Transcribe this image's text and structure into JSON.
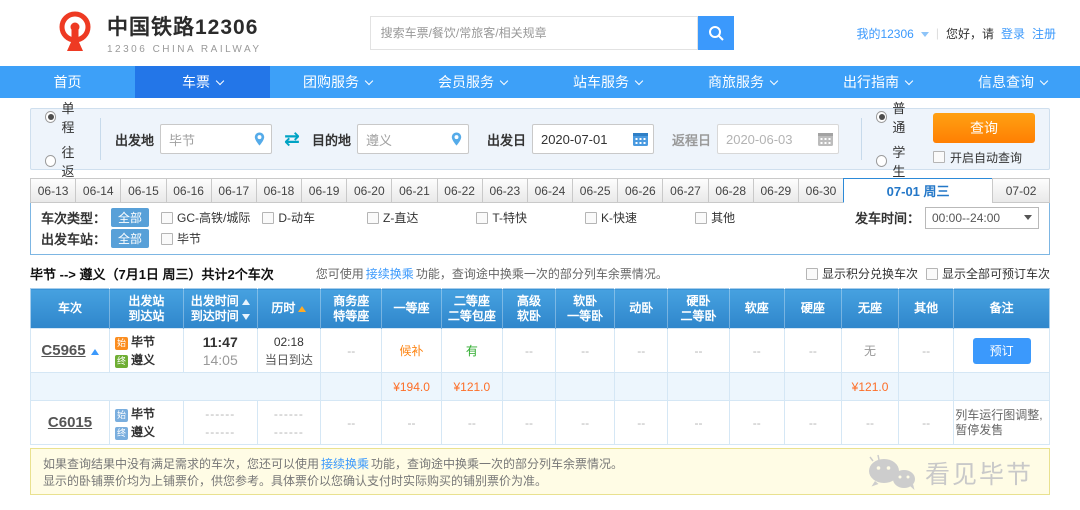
{
  "brand": {
    "title": "中国铁路12306",
    "subtitle": "12306 CHINA RAILWAY"
  },
  "topbar": {
    "search_placeholder": "搜索车票/餐饮/常旅客/相关规章",
    "my12306": "我的12306",
    "divider": "|",
    "greeting": "您好，请",
    "login": "登录",
    "register": "注册"
  },
  "nav": {
    "items": [
      {
        "label": "首页"
      },
      {
        "label": "车票"
      },
      {
        "label": "团购服务"
      },
      {
        "label": "会员服务"
      },
      {
        "label": "站车服务"
      },
      {
        "label": "商旅服务"
      },
      {
        "label": "出行指南"
      },
      {
        "label": "信息查询"
      }
    ]
  },
  "form": {
    "one_way": "单程",
    "round_trip": "往返",
    "from_label": "出发地",
    "from_value": "毕节",
    "to_label": "目的地",
    "to_value": "遵义",
    "depart_label": "出发日",
    "depart_value": "2020-07-01",
    "return_label": "返程日",
    "return_value": "2020-06-03",
    "normal": "普通",
    "student": "学生",
    "query": "查询",
    "auto_query": "开启自动查询"
  },
  "dates": {
    "items": [
      "06-13",
      "06-14",
      "06-15",
      "06-16",
      "06-17",
      "06-18",
      "06-19",
      "06-20",
      "06-21",
      "06-22",
      "06-23",
      "06-24",
      "06-25",
      "06-26",
      "06-27",
      "06-28",
      "06-29",
      "06-30"
    ],
    "selected": "07-01 周三",
    "next": "07-02"
  },
  "filters": {
    "type_label": "车次类型：",
    "all": "全部",
    "types": [
      "GC-高铁/城际",
      "D-动车",
      "Z-直达",
      "T-特快",
      "K-快速",
      "其他"
    ],
    "station_label": "出发车站：",
    "station": "毕节",
    "time_label": "发车时间：",
    "time_value": "00:00--24:00"
  },
  "results": {
    "summary": "毕节 --> 遵义（7月1日 周三）共计2个车次",
    "tip_prefix": "您可使用",
    "tip_link": "接续换乘",
    "tip_suffix": "功能，查询途中换乘一次的部分列车余票情况。",
    "show_points": "显示积分兑换车次",
    "show_all": "显示全部可预订车次"
  },
  "table": {
    "headers": {
      "train": "车次",
      "from": "出发站",
      "to": "到达站",
      "dep": "出发时间",
      "arr": "到达时间",
      "dur": "历时",
      "biz1": "商务座",
      "biz2": "特等座",
      "first": "一等座",
      "sec1": "二等座",
      "sec2": "二等包座",
      "advsoft1": "高级",
      "advsoft2": "软卧",
      "soft1": "软卧",
      "soft2": "一等卧",
      "dong": "动卧",
      "hard1": "硬卧",
      "hard2": "二等卧",
      "softseat": "软座",
      "hardseat": "硬座",
      "noseat": "无座",
      "other": "其他",
      "remark": "备注"
    },
    "row1": {
      "train_no": "C5965",
      "from_badge": "始",
      "from": "毕节",
      "to_badge": "终",
      "to": "遵义",
      "dep": "11:47",
      "arr": "14:05",
      "dur": "02:18",
      "day": "当日到达",
      "business": "--",
      "first_class": "候补",
      "second_class": "有",
      "adv_soft": "--",
      "soft_sleeper": "--",
      "dong_sleeper": "--",
      "hard_sleeper": "--",
      "soft_seat": "--",
      "hard_seat": "--",
      "no_seat": "无",
      "other": "--",
      "book": "预订"
    },
    "price_row": {
      "first_class": "¥194.0",
      "second_class": "¥121.0",
      "no_seat": "¥121.0"
    },
    "row2": {
      "train_no": "C6015",
      "from_badge": "始",
      "from": "毕节",
      "to_badge": "终",
      "to": "遵义",
      "dep": "------",
      "arr": "------",
      "dur1": "------",
      "dur2": "------",
      "business": "--",
      "first_class": "--",
      "second_class": "--",
      "adv_soft": "--",
      "soft_sleeper": "--",
      "dong_sleeper": "--",
      "hard_sleeper": "--",
      "soft_seat": "--",
      "hard_seat": "--",
      "no_seat": "--",
      "other": "--",
      "remark": "列车运行图调整,暂停发售"
    }
  },
  "note": {
    "line1_prefix": "如果查询结果中没有满足需求的车次，您还可以使用",
    "line1_link": "接续换乘",
    "line1_suffix": "功能，查询途中换乘一次的部分列车余票情况。",
    "line2": "显示的卧铺票价均为上铺票价，供您参考。具体票价以您确认支付时实际购买的铺别票价为准。"
  },
  "watermark": "看见毕节",
  "colors": {
    "nav_blue": "#3da0f8",
    "nav_active_blue": "#2376e8",
    "brand_red": "#ee3a23",
    "query_orange": "#ff8502",
    "link_blue": "#3b99fc",
    "price_orange": "#fd6e27",
    "available_green": "#2cab2c",
    "waitlist_orange": "#fd8311",
    "table_header_blue": "#2f86cb"
  }
}
